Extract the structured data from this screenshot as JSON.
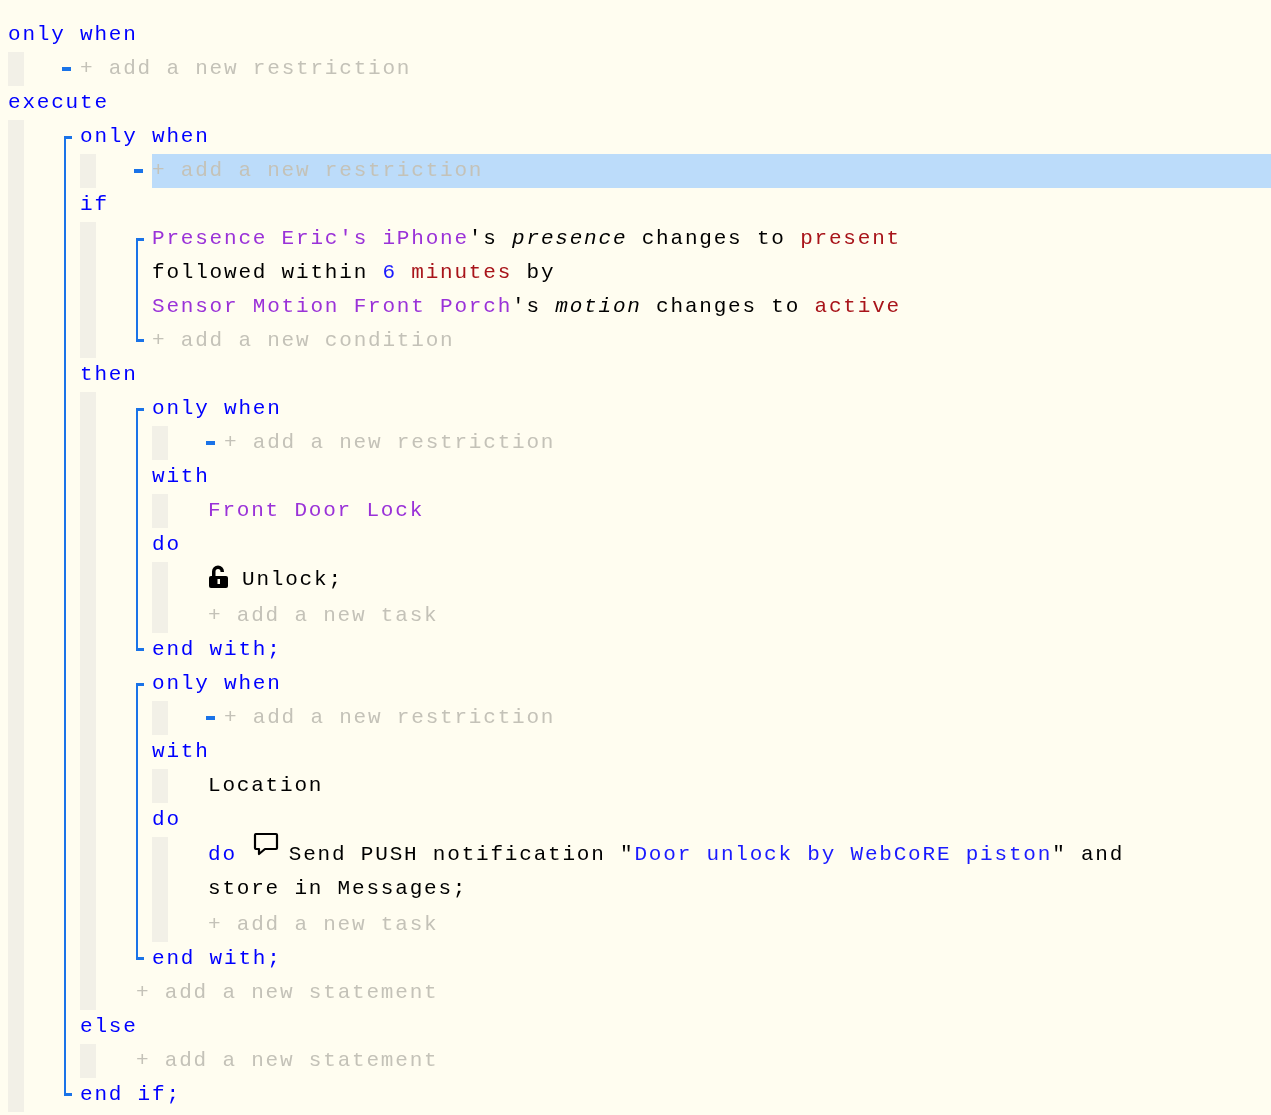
{
  "piston": [
    {
      "kind": "section",
      "keyword": "only when",
      "children": [
        {
          "kind": "restriction_add",
          "text": "+ add a new restriction",
          "selected": false
        }
      ]
    },
    {
      "kind": "section",
      "keyword": "execute",
      "children": [
        {
          "kind": "group",
          "children": [
            {
              "kind": "section",
              "keyword": "only when",
              "children": [
                {
                  "kind": "restriction_add",
                  "text": "+ add a new restriction",
                  "selected": true
                }
              ]
            },
            {
              "kind": "section",
              "keyword": "if",
              "children": [
                {
                  "kind": "group",
                  "children": [
                    {
                      "kind": "line",
                      "tokens": [
                        {
                          "kind": "device",
                          "text": "Presence Eric's iPhone"
                        },
                        {
                          "kind": "plain",
                          "text": "'s "
                        },
                        {
                          "kind": "attribute",
                          "text": "presence"
                        },
                        {
                          "kind": "plain",
                          "text": " changes to "
                        },
                        {
                          "kind": "value",
                          "text": "present"
                        }
                      ]
                    },
                    {
                      "kind": "line",
                      "tokens": [
                        {
                          "kind": "plain",
                          "text": "followed within "
                        },
                        {
                          "kind": "number",
                          "text": "6 "
                        },
                        {
                          "kind": "value",
                          "text": "minutes"
                        },
                        {
                          "kind": "plain",
                          "text": " by"
                        }
                      ]
                    },
                    {
                      "kind": "line",
                      "tokens": [
                        {
                          "kind": "device",
                          "text": "Sensor Motion Front Porch"
                        },
                        {
                          "kind": "plain",
                          "text": "'s "
                        },
                        {
                          "kind": "attribute",
                          "text": "motion"
                        },
                        {
                          "kind": "plain",
                          "text": " changes to "
                        },
                        {
                          "kind": "value",
                          "text": "active"
                        }
                      ]
                    },
                    {
                      "kind": "add",
                      "text": "+ add a new condition"
                    }
                  ]
                }
              ]
            },
            {
              "kind": "section",
              "keyword": "then",
              "children": [
                {
                  "kind": "group",
                  "children": [
                    {
                      "kind": "section",
                      "keyword": "only when",
                      "children": [
                        {
                          "kind": "restriction_add",
                          "text": "+ add a new restriction",
                          "selected": false
                        }
                      ]
                    },
                    {
                      "kind": "section",
                      "keyword": "with",
                      "children": [
                        {
                          "kind": "line",
                          "tokens": [
                            {
                              "kind": "device",
                              "text": "Front Door Lock"
                            }
                          ]
                        }
                      ]
                    },
                    {
                      "kind": "section",
                      "keyword": "do",
                      "children": [
                        {
                          "kind": "lock",
                          "lines": [
                            [
                              {
                                "kind": "plain",
                                "text": "Unlock;"
                              }
                            ]
                          ]
                        },
                        {
                          "kind": "add",
                          "text": "+ add a new task"
                        }
                      ]
                    },
                    {
                      "kind": "keyword",
                      "text": "end with;"
                    }
                  ]
                },
                {
                  "kind": "group",
                  "children": [
                    {
                      "kind": "section",
                      "keyword": "only when",
                      "children": [
                        {
                          "kind": "restriction_add",
                          "text": "+ add a new restriction",
                          "selected": false
                        }
                      ]
                    },
                    {
                      "kind": "section",
                      "keyword": "with",
                      "children": [
                        {
                          "kind": "line",
                          "tokens": [
                            {
                              "kind": "plain",
                              "text": "Location"
                            }
                          ]
                        }
                      ]
                    },
                    {
                      "kind": "section",
                      "keyword": "do",
                      "children": [
                        {
                          "kind": "notification",
                          "prefix": "do",
                          "lines": [
                            [
                              {
                                "kind": "plain",
                                "text": "Send PUSH notification \""
                              },
                              {
                                "kind": "string",
                                "text": "Door unlock by WebCoRE piston"
                              },
                              {
                                "kind": "plain",
                                "text": "\" and"
                              }
                            ],
                            [
                              {
                                "kind": "plain",
                                "text": "store in Messages;"
                              }
                            ]
                          ]
                        },
                        {
                          "kind": "add",
                          "text": "+ add a new task"
                        }
                      ]
                    },
                    {
                      "kind": "keyword",
                      "text": "end with;"
                    }
                  ]
                },
                {
                  "kind": "add",
                  "text": "+ add a new statement"
                }
              ]
            },
            {
              "kind": "section",
              "keyword": "else",
              "children": [
                {
                  "kind": "add",
                  "text": "+ add a new statement"
                }
              ]
            },
            {
              "kind": "keyword",
              "text": "end if;"
            }
          ]
        }
      ]
    }
  ]
}
